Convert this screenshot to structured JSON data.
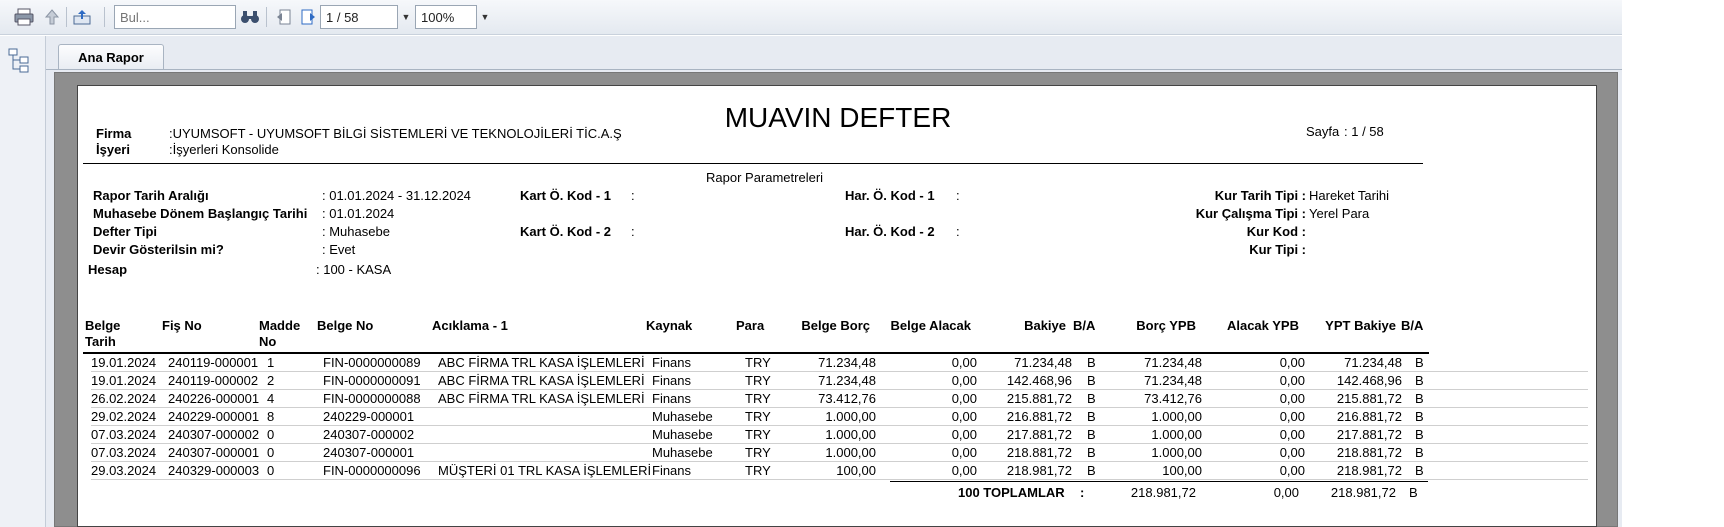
{
  "toolbar": {
    "search_placeholder": "Bul...",
    "page_value": "1 / 58",
    "zoom_value": "100%"
  },
  "tab": {
    "label": "Ana Rapor"
  },
  "report": {
    "title": "MUAVIN DEFTER",
    "firma_label": "Firma",
    "firma_value": ":UYUMSOFT - UYUMSOFT BİLGİ SİSTEMLERİ VE TEKNOLOJİLERİ TİC.A.Ş",
    "isyeri_label": "İşyeri",
    "isyeri_value": ":İşyerleri Konsolide",
    "sayfa_label": "Sayfa",
    "sayfa_value": ": 1 / 58",
    "params_title": "Rapor Parametreleri",
    "params": {
      "tarih_araligi_label": "Rapor Tarih Aralığı",
      "tarih_araligi_value": ": 01.01.2024 - 31.12.2024",
      "donem_label": "Muhasebe Dönem Başlangıç Tarihi",
      "donem_value": ": 01.01.2024",
      "defter_label": "Defter Tipi",
      "defter_value": ": Muhasebe",
      "devir_label": "Devir Gösterilsin mi?",
      "devir_value": ": Evet",
      "hesap_label": "Hesap",
      "hesap_value": ": 100 - KASA",
      "kart1_label": "Kart Ö. Kod - 1",
      "kart1_value": ":",
      "kart2_label": "Kart Ö. Kod - 2",
      "kart2_value": ":",
      "har1_label": "Har. Ö. Kod - 1",
      "har1_value": ":",
      "har2_label": "Har. Ö. Kod - 2",
      "har2_value": ":",
      "kur_tarih_label": "Kur Tarih Tipi :",
      "kur_tarih_value": "Hareket Tarihi",
      "kur_calisma_label": "Kur Çalışma Tipi :",
      "kur_calisma_value": "Yerel Para",
      "kur_kod_label": "Kur Kod :",
      "kur_tipi_label": "Kur Tipi :"
    },
    "columns": [
      "Belge\nTarih",
      "Fiş No",
      "Madde\nNo",
      "Belge No",
      "Acıklama - 1",
      "Kaynak",
      "Para",
      "Belge Borç",
      "Belge Alacak",
      "Bakiye",
      "B/A",
      "Borç YPB",
      "Alacak YPB",
      "YPT Bakiye",
      "B/A"
    ],
    "rows": [
      [
        "19.01.2024",
        "240119-000001",
        "1",
        "FIN-0000000089",
        "ABC FİRMA TRL KASA İŞLEMLERİ",
        "Finans",
        "TRY",
        "71.234,48",
        "0,00",
        "71.234,48",
        "B",
        "71.234,48",
        "0,00",
        "71.234,48",
        "B"
      ],
      [
        "19.01.2024",
        "240119-000002",
        "2",
        "FIN-0000000091",
        "ABC FİRMA TRL KASA İŞLEMLERİ",
        "Finans",
        "TRY",
        "71.234,48",
        "0,00",
        "142.468,96",
        "B",
        "71.234,48",
        "0,00",
        "142.468,96",
        "B"
      ],
      [
        "26.02.2024",
        "240226-000001",
        "4",
        "FIN-0000000088",
        "ABC FİRMA TRL KASA İŞLEMLERİ",
        "Finans",
        "TRY",
        "73.412,76",
        "0,00",
        "215.881,72",
        "B",
        "73.412,76",
        "0,00",
        "215.881,72",
        "B"
      ],
      [
        "29.02.2024",
        "240229-000001",
        "8",
        "240229-000001",
        "",
        "Muhasebe",
        "TRY",
        "1.000,00",
        "0,00",
        "216.881,72",
        "B",
        "1.000,00",
        "0,00",
        "216.881,72",
        "B"
      ],
      [
        "07.03.2024",
        "240307-000002",
        "0",
        "240307-000002",
        "",
        "Muhasebe",
        "TRY",
        "1.000,00",
        "0,00",
        "217.881,72",
        "B",
        "1.000,00",
        "0,00",
        "217.881,72",
        "B"
      ],
      [
        "07.03.2024",
        "240307-000001",
        "0",
        "240307-000001",
        "",
        "Muhasebe",
        "TRY",
        "1.000,00",
        "0,00",
        "218.881,72",
        "B",
        "1.000,00",
        "0,00",
        "218.881,72",
        "B"
      ],
      [
        "29.03.2024",
        "240329-000003",
        "0",
        "FIN-0000000096",
        "MÜŞTERİ 01 TRL KASA İŞLEMLERİ",
        "Finans",
        "TRY",
        "100,00",
        "0,00",
        "218.981,72",
        "B",
        "100,00",
        "0,00",
        "218.981,72",
        "B"
      ]
    ],
    "totals": {
      "label": "100 TOPLAMLAR",
      "colon": ":",
      "borc_ypb": "218.981,72",
      "alacak_ypb": "0,00",
      "ypt_bakiye": "218.981,72",
      "ba": "B"
    }
  }
}
